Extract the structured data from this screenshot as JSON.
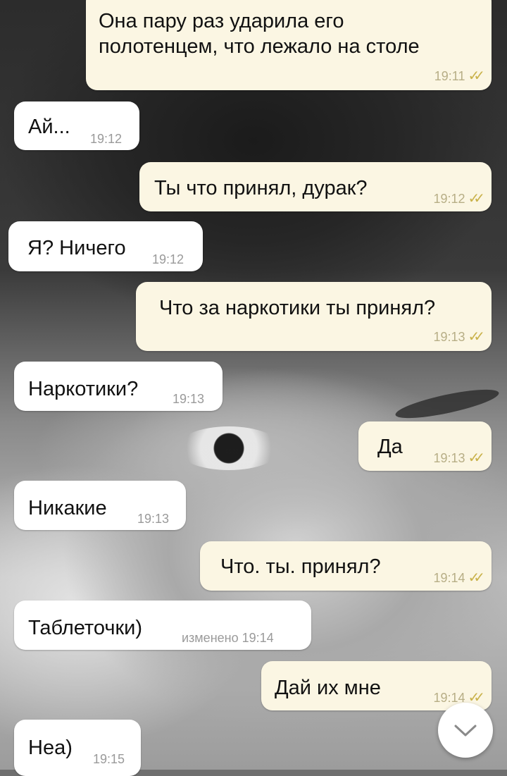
{
  "messages": [
    {
      "dir": "out",
      "text": "Она пару раз ударила его\nполотенцем, что лежало на столе",
      "time": "19:11"
    },
    {
      "dir": "in",
      "text": "Ай...",
      "time": "19:12"
    },
    {
      "dir": "out",
      "text": "Ты что принял, дурак?",
      "time": "19:12"
    },
    {
      "dir": "in",
      "text": "Я? Ничего",
      "time": "19:12"
    },
    {
      "dir": "out",
      "text": "Что за наркотики ты принял?",
      "time": "19:13"
    },
    {
      "dir": "in",
      "text": "Наркотики?",
      "time": "19:13"
    },
    {
      "dir": "out",
      "text": "Да",
      "time": "19:13"
    },
    {
      "dir": "in",
      "text": "Никакие",
      "time": "19:13"
    },
    {
      "dir": "out",
      "text": "Что. ты. принял?",
      "time": "19:14"
    },
    {
      "dir": "in",
      "text": "Таблеточки)",
      "time": "изменено 19:14"
    },
    {
      "dir": "out",
      "text": "Дай их мне",
      "time": "19:14"
    },
    {
      "dir": "in",
      "text": "Неа)",
      "time": "19:15"
    }
  ],
  "read_ticks": "✓✓",
  "scroll_button_icon": "chevron-down-icon"
}
